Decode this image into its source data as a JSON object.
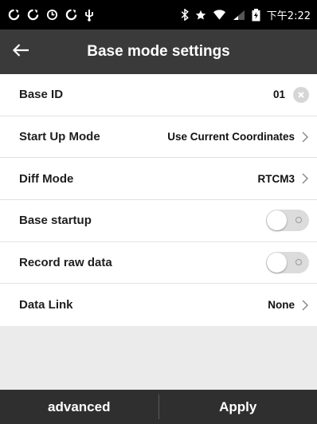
{
  "status_bar": {
    "left_icons": [
      "sync-icon",
      "sync-icon",
      "clock-sync-icon",
      "sync-icon",
      "usb-icon"
    ],
    "right_icons": [
      "bluetooth-icon",
      "star-icon",
      "wifi-signal-icon",
      "cellular-signal-icon",
      "battery-charging-icon"
    ],
    "time": "下午2:22"
  },
  "header": {
    "title": "Base mode settings",
    "back_icon": "arrow-left-icon"
  },
  "settings": {
    "base_id": {
      "label": "Base ID",
      "value": "01"
    },
    "start_up_mode": {
      "label": "Start Up Mode",
      "value": "Use Current Coordinates"
    },
    "diff_mode": {
      "label": "Diff Mode",
      "value": "RTCM3"
    },
    "base_startup": {
      "label": "Base startup",
      "enabled": false
    },
    "record_raw_data": {
      "label": "Record raw data",
      "enabled": false
    },
    "data_link": {
      "label": "Data Link",
      "value": "None"
    }
  },
  "footer": {
    "advanced_label": "advanced",
    "apply_label": "Apply"
  },
  "colors": {
    "status_bar": "#000000",
    "title_bar": "#3a3a3a",
    "bottom_bar": "#2f2f2f",
    "page_background": "#ebebeb",
    "toggle_off": "#dcdcdc"
  }
}
